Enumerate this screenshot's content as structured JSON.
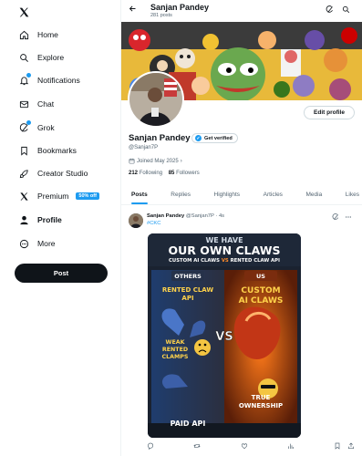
{
  "nav": {
    "items": [
      {
        "label": "Home",
        "icon": "home-icon"
      },
      {
        "label": "Explore",
        "icon": "search-icon"
      },
      {
        "label": "Notifications",
        "icon": "bell-icon"
      },
      {
        "label": "Chat",
        "icon": "mail-icon"
      },
      {
        "label": "Grok",
        "icon": "grok-icon"
      },
      {
        "label": "Bookmarks",
        "icon": "bookmark-icon"
      },
      {
        "label": "Creator Studio",
        "icon": "rocket-icon"
      },
      {
        "label": "Premium",
        "icon": "x-icon",
        "badge": "50% off"
      },
      {
        "label": "Profile",
        "icon": "person-icon",
        "active": true
      },
      {
        "label": "More",
        "icon": "more-icon"
      }
    ],
    "post_label": "Post"
  },
  "header": {
    "name": "Sanjan Pandey",
    "posts": "281 posts"
  },
  "profile": {
    "name": "Sanjan Pandey",
    "verified_label": "Get verified",
    "handle": "@Sanjan7P",
    "joined": "Joined May 2025",
    "following_count": "212",
    "following_label": "Following",
    "followers_count": "85",
    "followers_label": "Followers",
    "edit_label": "Edit profile"
  },
  "tabs": [
    "Posts",
    "Replies",
    "Highlights",
    "Articles",
    "Media",
    "Likes"
  ],
  "tweet": {
    "name": "Sanjan Pandey",
    "handle": "@Sanjan7P",
    "time": "· 4s",
    "hashtag": "#CKC",
    "image": {
      "title_top": "WE HAVE",
      "title_main": "OUR OWN CLAWS",
      "subtitle_left": "CUSTOM AI CLAWS",
      "subtitle_vs": "VS",
      "subtitle_right": "RENTED CLAW API",
      "left_header": "OTHERS",
      "right_header": "US",
      "left_title_1": "RENTED CLAW",
      "left_title_2": "API",
      "right_title_1": "CUSTOM",
      "right_title_2": "AI CLAWS",
      "vs": "VS",
      "weak_1": "WEAK",
      "weak_2": "RENTED",
      "weak_3": "CLAMPS",
      "true_1": "TRUE",
      "true_2": "OWNERSHIP",
      "paid": "PAID API"
    }
  },
  "colors": {
    "accent": "#1d9bf0",
    "text": "#0f1419",
    "muted": "#536471",
    "border": "#eff3f4"
  }
}
